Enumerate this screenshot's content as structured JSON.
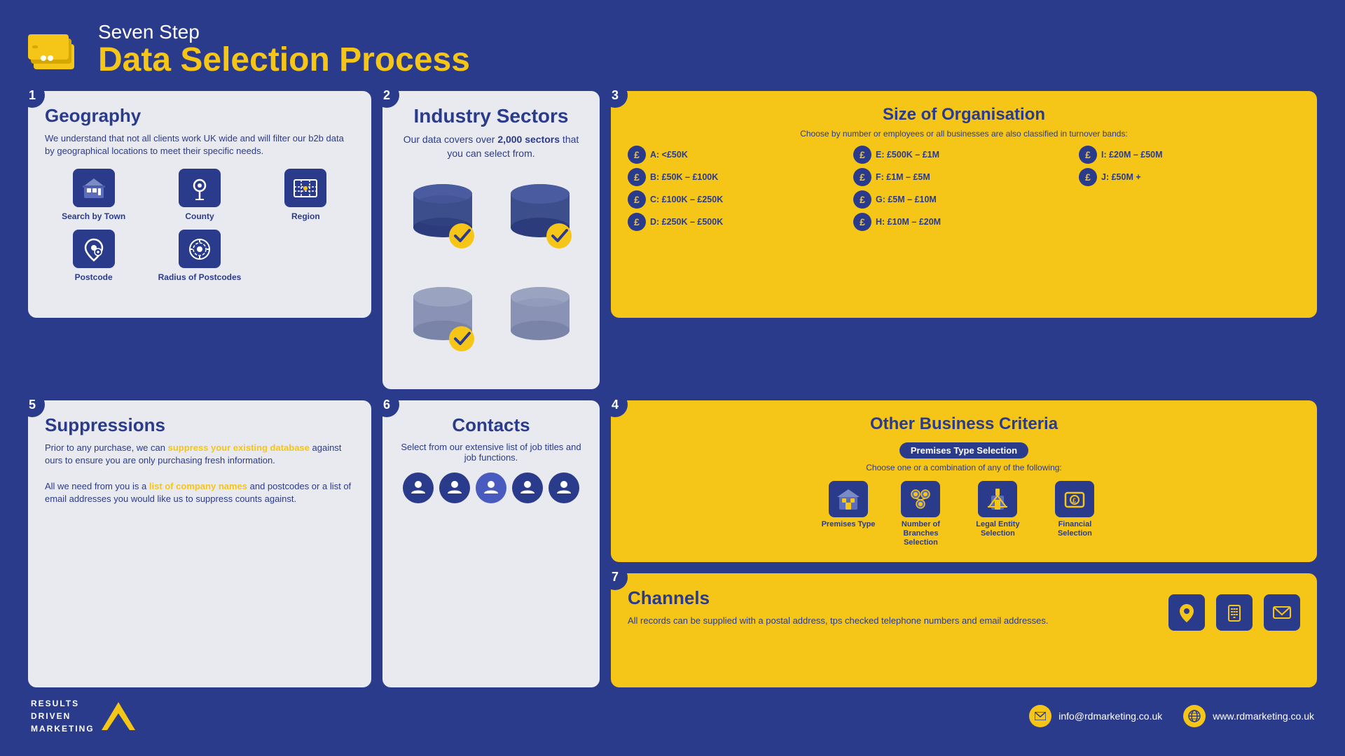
{
  "header": {
    "subtitle": "Seven Step",
    "title": "Data Selection Process"
  },
  "steps": {
    "geography": {
      "step": "1",
      "title": "Geography",
      "body": "We understand that not all clients work UK wide and will filter our b2b data by geographical locations to meet their specific needs.",
      "icons": [
        {
          "label": "Search by Town",
          "icon": "🏙"
        },
        {
          "label": "County",
          "icon": "📍"
        },
        {
          "label": "Region",
          "icon": "🗺"
        },
        {
          "label": "Postcode",
          "icon": "📌"
        },
        {
          "label": "Radius of Postcodes",
          "icon": "🎯"
        }
      ]
    },
    "industry": {
      "step": "2",
      "title": "Industry Sectors",
      "desc": "Our data covers over ",
      "highlight": "2,000 sectors",
      "desc2": " that you can select from."
    },
    "size": {
      "step": "3",
      "title": "Size of Organisation",
      "desc": "Choose by number or employees or all businesses are also classified in turnover bands:",
      "items": [
        "A: <£50K",
        "E: £500K – £1M",
        "I: £20M – £50M",
        "B: £50K – £100K",
        "F: £1M – £5M",
        "J: £50M +",
        "C: £100K – £250K",
        "G: £5M – £10M",
        "",
        "D: £250K – £500K",
        "H: £10M – £20M",
        ""
      ]
    },
    "other": {
      "step": "4",
      "title": "Other Business Criteria",
      "badge": "Premises Type Selection",
      "desc": "Choose one or a combination of any of the following:",
      "icons": [
        {
          "label": "Premises Type",
          "icon": "🏢"
        },
        {
          "label": "Number of Branches Selection",
          "icon": "👥"
        },
        {
          "label": "Legal Entity Selection",
          "icon": "⚖"
        },
        {
          "label": "Financial Selection",
          "icon": "💷"
        }
      ]
    },
    "suppressions": {
      "step": "5",
      "title": "Suppressions",
      "body1": "Prior to any purchase, we can ",
      "link": "suppress your existing database",
      "body2": " against ours to ensure you are only purchasing fresh information.",
      "body3": "All we need from you is a ",
      "link2": "list of company names",
      "body4": " and postcodes or a list of email addresses you would like us to suppress counts against."
    },
    "contacts": {
      "step": "6",
      "title": "Contacts",
      "desc": "Select from our extensive list of job titles and job functions."
    },
    "channels": {
      "step": "7",
      "title": "Channels",
      "body": "All records can be supplied with a postal address, tps checked telephone numbers and email addresses.",
      "icons": [
        "📍",
        "📞",
        "✉"
      ]
    }
  },
  "footer": {
    "logo_line1": "RESULTS",
    "logo_line2": "DRIVEN",
    "logo_line3": "MARKETING",
    "email": "info@rdmarketing.co.uk",
    "website": "www.rdmarketing.co.uk"
  }
}
